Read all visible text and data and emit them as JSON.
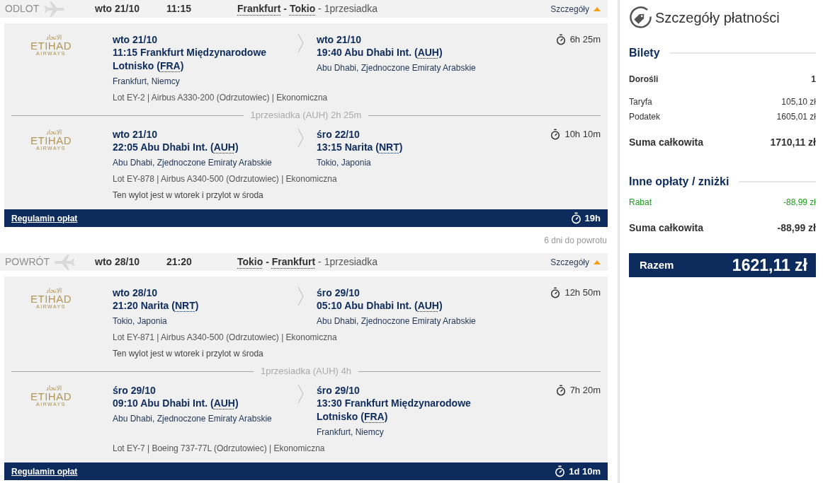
{
  "journeys": [
    {
      "kind": "outbound",
      "label": "ODLOT",
      "date": "wto 21/10",
      "time": "11:15",
      "route": [
        {
          "kind": "city",
          "text": "Frankfurt"
        },
        {
          "kind": "joiner",
          "text": "-"
        },
        {
          "kind": "city",
          "text": "Tokio"
        },
        {
          "kind": "plain",
          "text": "- 1przesiadka"
        }
      ],
      "details": "Szczegóły",
      "expanded": true,
      "segments": [
        {
          "airline": {
            "script": "الاتحاد",
            "name": "ETIHAD",
            "tagline": "AIRWAYS"
          },
          "departure": {
            "date": "wto 21/10",
            "time": "11:15",
            "airport": "Frankfurt Międzynarodowe Lotnisko",
            "code": "(FRA)",
            "city": "Frankfurt, Niemcy"
          },
          "arrival": {
            "date": "wto 21/10",
            "time": "19:40",
            "airport": "Abu Dhabi Int.",
            "code": "(AUH)",
            "city": "Abu Dhabi, Zjednoczone Emiraty Arabskie"
          },
          "duration": "6h 25m",
          "flight_info": "Lot EY-2 | Airbus A330-200 (Odrzutowiec) | Ekonomiczna"
        },
        {
          "layover": "1przesiadka (AUH) 2h 25m",
          "airline": {
            "script": "الاتحاد",
            "name": "ETIHAD",
            "tagline": "AIRWAYS"
          },
          "departure": {
            "date": "wto 21/10",
            "time": "22:05",
            "airport": "Abu Dhabi Int.",
            "code": "(AUH)",
            "city": "Abu Dhabi, Zjednoczone Emiraty Arabskie"
          },
          "arrival": {
            "date": "śro 22/10",
            "time": "13:15",
            "airport": "Narita",
            "code": "(NRT)",
            "city": "Tokio, Japonia"
          },
          "duration": "10h 10m",
          "flight_info": "Lot EY-878 | Airbus A340-500 (Odrzutowiec) | Ekonomiczna",
          "note": "Ten wylot jest w wtorek i przylot w środa"
        }
      ],
      "fare_rules": "Regulamin opłat",
      "total_duration": "19h"
    },
    {
      "kind": "return",
      "countdown": "6 dni do powrotu",
      "label": "POWRÓT",
      "date": "wto 28/10",
      "time": "21:20",
      "route": [
        {
          "kind": "city",
          "text": "Tokio"
        },
        {
          "kind": "joiner",
          "text": "-"
        },
        {
          "kind": "city",
          "text": "Frankfurt"
        },
        {
          "kind": "plain",
          "text": "- 1przesiadka"
        }
      ],
      "details": "Szczegóły",
      "expanded": true,
      "segments": [
        {
          "airline": {
            "script": "الاتحاد",
            "name": "ETIHAD",
            "tagline": "AIRWAYS"
          },
          "departure": {
            "date": "wto 28/10",
            "time": "21:20",
            "airport": "Narita",
            "code": "(NRT)",
            "city": "Tokio, Japonia"
          },
          "arrival": {
            "date": "śro 29/10",
            "time": "05:10",
            "airport": "Abu Dhabi Int.",
            "code": "(AUH)",
            "city": "Abu Dhabi, Zjednoczone Emiraty Arabskie"
          },
          "duration": "12h 50m",
          "flight_info": "Lot EY-871 | Airbus A340-500 (Odrzutowiec) | Ekonomiczna",
          "note": "Ten wylot jest w wtorek i przylot w środa"
        },
        {
          "layover": "1przesiadka (AUH) 4h",
          "airline": {
            "script": "الاتحاد",
            "name": "ETIHAD",
            "tagline": "AIRWAYS"
          },
          "departure": {
            "date": "śro 29/10",
            "time": "09:10",
            "airport": "Abu Dhabi Int.",
            "code": "(AUH)",
            "city": "Abu Dhabi, Zjednoczone Emiraty Arabskie"
          },
          "arrival": {
            "date": "śro 29/10",
            "time": "13:30",
            "airport": "Frankfurt Międzynarodowe Lotnisko",
            "code": "(FRA)",
            "city": "Frankfurt, Niemcy"
          },
          "duration": "7h 20m",
          "flight_info": "Lot EY-7 | Boeing 737-77L (Odrzutowiec) | Ekonomiczna"
        }
      ],
      "fare_rules": "Regulamin opłat",
      "total_duration": "1d 10m"
    }
  ],
  "payment": {
    "title": "Szczegóły płatności",
    "sections": [
      {
        "title": "Bilety",
        "rows": [
          {
            "kind": "heading",
            "label": "Dorośli",
            "value": "1"
          },
          {
            "kind": "item",
            "label": "Taryfa",
            "value": "105,10 zł"
          },
          {
            "kind": "item",
            "label": "Podatek",
            "value": "1605,01 zł"
          },
          {
            "kind": "total",
            "label": "Suma całkowita",
            "value": "1710,11 zł"
          }
        ]
      },
      {
        "title": "Inne opłaty / zniżki",
        "rows": [
          {
            "kind": "discount",
            "label": "Rabat",
            "value": "-88,99 zł"
          },
          {
            "kind": "total",
            "label": "Suma całkowita",
            "value": "-88,99 zł"
          }
        ]
      }
    ],
    "grand_total": {
      "label": "Razem",
      "value": "1621,11 zł"
    }
  }
}
